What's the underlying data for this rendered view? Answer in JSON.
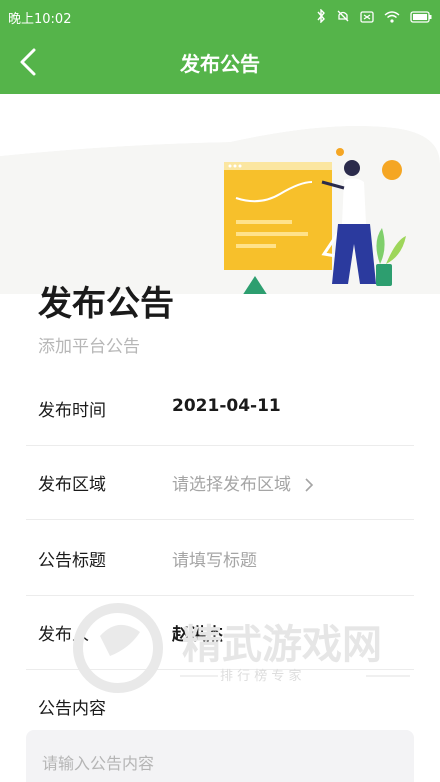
{
  "status_bar": {
    "time": "晚上10:02"
  },
  "header": {
    "title": "发布公告"
  },
  "hero": {
    "title": "发布公告",
    "subtitle": "添加平台公告"
  },
  "form": {
    "publish_time": {
      "label": "发布时间",
      "value": "2021-04-11"
    },
    "publish_area": {
      "label": "发布区域",
      "placeholder": "请选择发布区域"
    },
    "notice_title": {
      "label": "公告标题",
      "placeholder": "请填写标题"
    },
    "publisher": {
      "label": "发布人",
      "value": "赵洪杰"
    },
    "notice_content": {
      "label": "公告内容",
      "placeholder": "请输入公告内容"
    }
  },
  "watermark": {
    "main": "精武游戏网",
    "sub": "排 行 榜 专 家"
  },
  "colors": {
    "brand_green": "#55b44a",
    "accent_yellow": "#f7c02b",
    "accent_orange": "#f5a623"
  }
}
